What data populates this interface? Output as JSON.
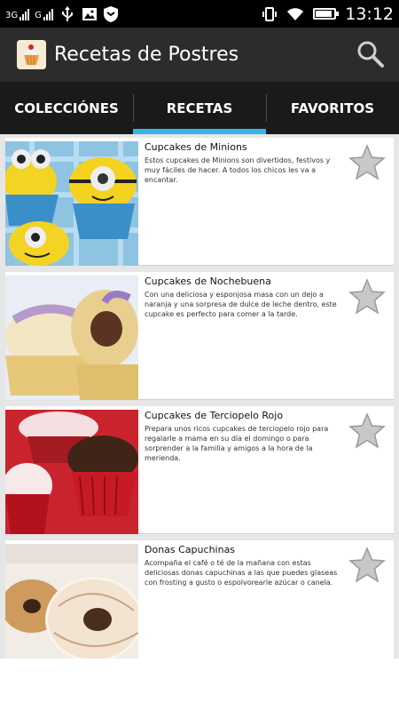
{
  "status_bar": {
    "network_1": "3G",
    "network_2": "G",
    "time": "13:12",
    "battery_level": 0.9
  },
  "app": {
    "title": "Recetas de Postres",
    "icon": "cupcake-app-icon",
    "search_icon": "search-icon"
  },
  "tabs": [
    {
      "label": "COLECCIÓNES",
      "active": false
    },
    {
      "label": "RECETAS",
      "active": true
    },
    {
      "label": "FAVORITOS",
      "active": false
    }
  ],
  "recipes": [
    {
      "title": "Cupcakes de Minions",
      "description": "Estos cupcakes de Minions son divertidos, festivos y muy fáciles de hacer. A todos los chicos les va a encantar.",
      "image": "minion-cupcakes-photo",
      "favorite": false
    },
    {
      "title": "Cupcakes de Nochebuena",
      "description": "Con una deliciosa y esponjosa masa con un dejo a naranja y una sorpresa de dulce de leche dentro, este cupcake es perfecto para comer a la tarde.",
      "image": "christmas-cupcakes-photo",
      "favorite": false
    },
    {
      "title": "Cupcakes de Terciopelo Rojo",
      "description": "Prepara unos ricos cupcakes de terciopelo rojo para regalarle a mama en su día el domingo o para sorprender a la familia y amigos a la hora de la merienda.",
      "image": "red-velvet-cupcakes-photo",
      "favorite": false
    },
    {
      "title": "Donas Capuchinas",
      "description": "Acompaña el café o té de la mañana con estas deliciosas donas capuchinas a las que puedes glaseas con frosting a gusto o espolvorearle azúcar o canela.",
      "image": "cappuccino-donuts-photo",
      "favorite": false
    }
  ],
  "colors": {
    "status_bar": "#000000",
    "action_bar": "#2c2c2c",
    "tab_bar": "#1a1a1a",
    "tab_indicator": "#33b5e5",
    "list_background": "#e6e6e6"
  }
}
